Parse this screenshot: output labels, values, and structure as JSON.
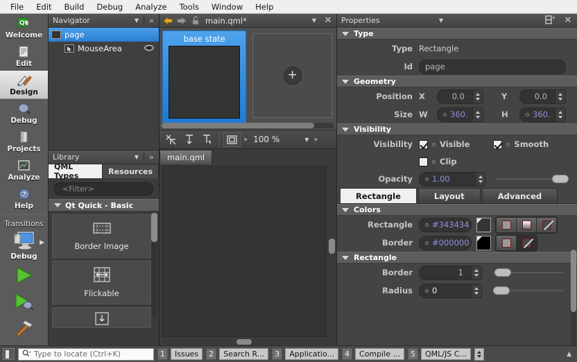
{
  "menubar": {
    "items": [
      "File",
      "Edit",
      "Build",
      "Debug",
      "Analyze",
      "Tools",
      "Window",
      "Help"
    ]
  },
  "modebar": {
    "modes": [
      {
        "label": "Welcome",
        "icon": "qt-logo-icon",
        "selected": false
      },
      {
        "label": "Edit",
        "icon": "document-icon",
        "selected": false
      },
      {
        "label": "Design",
        "icon": "brush-pencil-icon",
        "selected": true
      },
      {
        "label": "Debug",
        "icon": "bug-icon",
        "selected": false
      },
      {
        "label": "Projects",
        "icon": "folder-icon",
        "selected": false
      },
      {
        "label": "Analyze",
        "icon": "grid-chart-icon",
        "selected": false
      },
      {
        "label": "Help",
        "icon": "question-mark-icon",
        "selected": false
      }
    ],
    "transitions_label": "Transitions",
    "kit": {
      "label": "Debug",
      "icon": "monitor-icon"
    },
    "run_button": "run-icon",
    "debug_button": "debug-icon",
    "build_button": "hammer-icon"
  },
  "navigator": {
    "title": "Navigator",
    "items": [
      {
        "label": "page",
        "selected": true,
        "indent": 0,
        "icon": "rectangle-icon",
        "eye": false
      },
      {
        "label": "MouseArea",
        "selected": false,
        "indent": 1,
        "icon": "cursor-icon",
        "eye": true
      }
    ]
  },
  "library": {
    "title": "Library",
    "tabs": [
      {
        "label": "QML Types",
        "selected": true
      },
      {
        "label": "Resources",
        "selected": false
      }
    ],
    "filter_placeholder": "<Filter>",
    "group": "Qt Quick - Basic",
    "items": [
      {
        "label": "Border Image",
        "icon": "border-image-icon"
      },
      {
        "label": "Flickable",
        "icon": "flickable-icon"
      }
    ]
  },
  "editor": {
    "filename": "main.qml*",
    "document_tab": "main.qml",
    "zoom": "100 %",
    "states": [
      {
        "label": "base state",
        "selected": true
      },
      {
        "label": "",
        "selected": false,
        "add": true
      }
    ]
  },
  "properties": {
    "title": "Properties",
    "sections": {
      "type": {
        "header": "Type",
        "type_label": "Type",
        "type_value": "Rectangle",
        "id_label": "Id",
        "id_value": "page"
      },
      "geometry": {
        "header": "Geometry",
        "position_label": "Position",
        "x_label": "X",
        "x_value": "0.0",
        "y_label": "Y",
        "y_value": "0.0",
        "size_label": "Size",
        "w_label": "W",
        "w_value": "360.",
        "h_label": "H",
        "h_value": "360."
      },
      "visibility": {
        "header": "Visibility",
        "visibility_label": "Visibility",
        "visible_label": "Visible",
        "visible_checked": true,
        "smooth_label": "Smooth",
        "smooth_checked": true,
        "clip_label": "Clip",
        "clip_checked": false,
        "opacity_label": "Opacity",
        "opacity_value": "1.00"
      },
      "colors": {
        "header": "Colors",
        "rectangle_label": "Rectangle",
        "rectangle_color": "#343434",
        "border_label": "Border",
        "border_color": "#000000"
      },
      "rectangle": {
        "header": "Rectangle",
        "border_label": "Border",
        "border_value": "1",
        "radius_label": "Radius",
        "radius_value": "0"
      }
    },
    "tabs": [
      {
        "label": "Rectangle",
        "selected": true
      },
      {
        "label": "Layout",
        "selected": false
      },
      {
        "label": "Advanced",
        "selected": false
      }
    ]
  },
  "statusbar": {
    "locator_placeholder": "Type to locate (Ctrl+K)",
    "panes": [
      {
        "num": "1",
        "label": "Issues"
      },
      {
        "num": "2",
        "label": "Search R..."
      },
      {
        "num": "3",
        "label": "Applicatio..."
      },
      {
        "num": "4",
        "label": "Compile ..."
      },
      {
        "num": "5",
        "label": "QML/JS C..."
      }
    ]
  }
}
